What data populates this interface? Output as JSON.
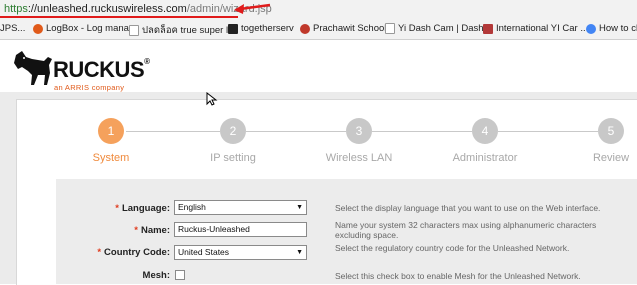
{
  "browser": {
    "url_scheme": "https",
    "url_host": "://unleashed.ruckuswireless.com",
    "url_path": "/admin/wizard.jsp",
    "bookmarks": [
      {
        "label": "JPS...",
        "icon": "page-icon",
        "color": "#888888"
      },
      {
        "label": "LogBox - Log mana...",
        "icon": "dog-icon",
        "color": "#e05a1a"
      },
      {
        "label": "ปลดล็อค true super l...",
        "icon": "page-icon",
        "color": "#555555"
      },
      {
        "label": "togetherserv",
        "icon": "tv-icon",
        "color": "#222222"
      },
      {
        "label": "Prachawit School",
        "icon": "school-icon",
        "color": "#c0392b"
      },
      {
        "label": "Yi Dash Cam | Dash...",
        "icon": "page-icon",
        "color": "#666666"
      },
      {
        "label": "International YI Car ...",
        "icon": "yi-icon",
        "color": "#b33939"
      },
      {
        "label": "How to cha",
        "icon": "google-icon",
        "color": "#4285f4"
      }
    ]
  },
  "header": {
    "brand": "RUCKUS",
    "trademark": "®",
    "tagline": "an ARRIS company"
  },
  "wizard": {
    "steps": [
      {
        "number": "1",
        "label": "System",
        "active": true
      },
      {
        "number": "2",
        "label": "IP setting",
        "active": false
      },
      {
        "number": "3",
        "label": "Wireless LAN",
        "active": false
      },
      {
        "number": "4",
        "label": "Administrator",
        "active": false
      },
      {
        "number": "5",
        "label": "Review",
        "active": false
      }
    ],
    "accent_color": "#f5a15c"
  },
  "form": {
    "required_mark": "*",
    "language": {
      "label": "Language:",
      "value": "English",
      "help": "Select the display language that you want to use on the Web interface."
    },
    "name": {
      "label": "Name:",
      "value": "Ruckus-Unleashed",
      "help": "Name your system 32 characters max using alphanumeric characters excluding space."
    },
    "country_code": {
      "label": "Country Code:",
      "value": "United States",
      "help": "Select the regulatory country code for the Unleashed Network."
    },
    "mesh": {
      "label": "Mesh:",
      "checked": false,
      "help": "Select this check box to enable Mesh for the Unleashed Network."
    }
  }
}
